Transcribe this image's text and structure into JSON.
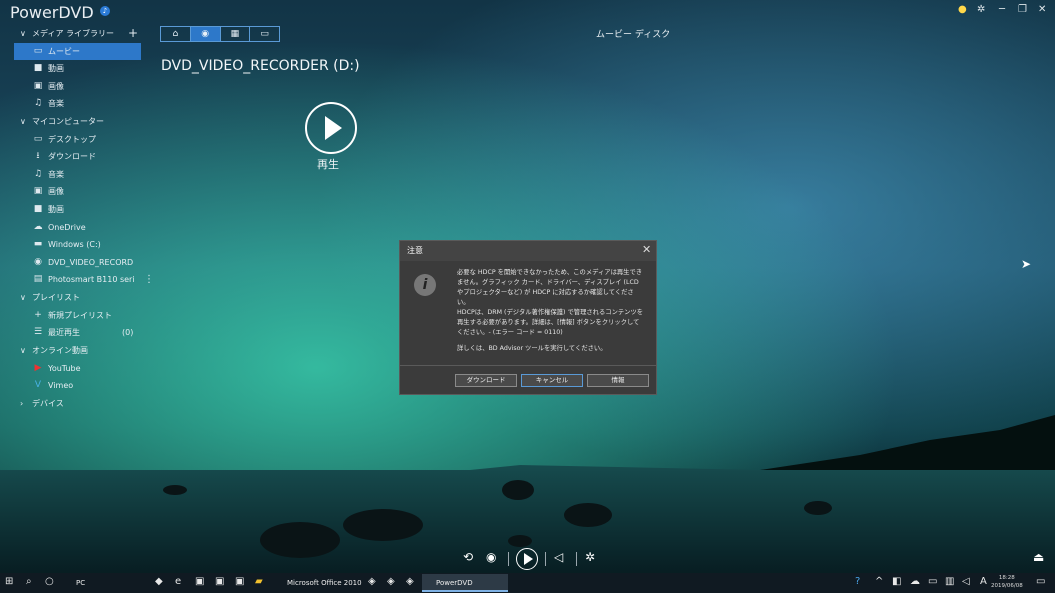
{
  "app": {
    "title": "PowerDVD",
    "bell_icon": "bell-icon"
  },
  "window_buttons": [
    "lightbulb-icon",
    "gear-icon",
    "restore-icon",
    "close-icon"
  ],
  "sidebar": {
    "media_library": "メディア ライブラリー",
    "media_items": [
      {
        "label": "ムービー",
        "icon": "movie-icon"
      },
      {
        "label": "動画",
        "icon": "video-icon"
      },
      {
        "label": "画像",
        "icon": "image-icon"
      },
      {
        "label": "音楽",
        "icon": "music-icon"
      }
    ],
    "my_computer": "マイコンピューター",
    "computer_items": [
      {
        "label": "デスクトップ",
        "icon": "desktop-icon"
      },
      {
        "label": "ダウンロード",
        "icon": "download-icon"
      },
      {
        "label": "音楽",
        "icon": "music-icon"
      },
      {
        "label": "画像",
        "icon": "image-icon"
      },
      {
        "label": "動画",
        "icon": "video-icon"
      },
      {
        "label": "OneDrive",
        "icon": "cloud-icon"
      },
      {
        "label": "Windows (C:)",
        "icon": "drive-icon"
      },
      {
        "label": "DVD_VIDEO_RECORD",
        "icon": "disc-icon"
      },
      {
        "label": "Photosmart B110 serie",
        "icon": "printer-icon"
      }
    ],
    "playlists": "プレイリスト",
    "playlist_items": [
      {
        "label": "新規プレイリスト",
        "icon": "plus-icon"
      },
      {
        "label": "最近再生",
        "icon": "recent-icon",
        "count": "(0)"
      }
    ],
    "online": "オンライン動画",
    "online_items": [
      {
        "label": "YouTube",
        "icon": "youtube-icon"
      },
      {
        "label": "Vimeo",
        "icon": "vimeo-icon"
      }
    ],
    "devices": "デバイス"
  },
  "nav": {
    "tabs": [
      "home-icon",
      "disc-icon",
      "film-icon",
      "tv-icon"
    ],
    "view_title": "ムービー ディスク"
  },
  "disc": {
    "title": "DVD_VIDEO_RECORDER (D:)",
    "play_label": "再生"
  },
  "dialog": {
    "title": "注意",
    "body_1": "必要な HDCP を開始できなかったため、このメディアは再生できません。グラフィック カード、ドライバー、ディスプレイ (LCD やプロジェクターなど) が HDCP に対応するか確認してください。",
    "body_2": "HDCPは、DRM (デジタル著作権保護) で管理されるコンテンツを再生する必要があります。詳細は、[情報] ボタンをクリックしてください。- (エラー コード = 0110)",
    "body_3": "詳しくは、BD Advisor ツールを実行してください。",
    "btn_download": "ダウンロード",
    "btn_cancel": "キャンセル",
    "btn_info": "情報"
  },
  "taskbar": {
    "apps": [
      "PC",
      "Microsoft Office 2010",
      "PowerDVD"
    ],
    "time": "18:28",
    "date": "2019/06/08"
  }
}
